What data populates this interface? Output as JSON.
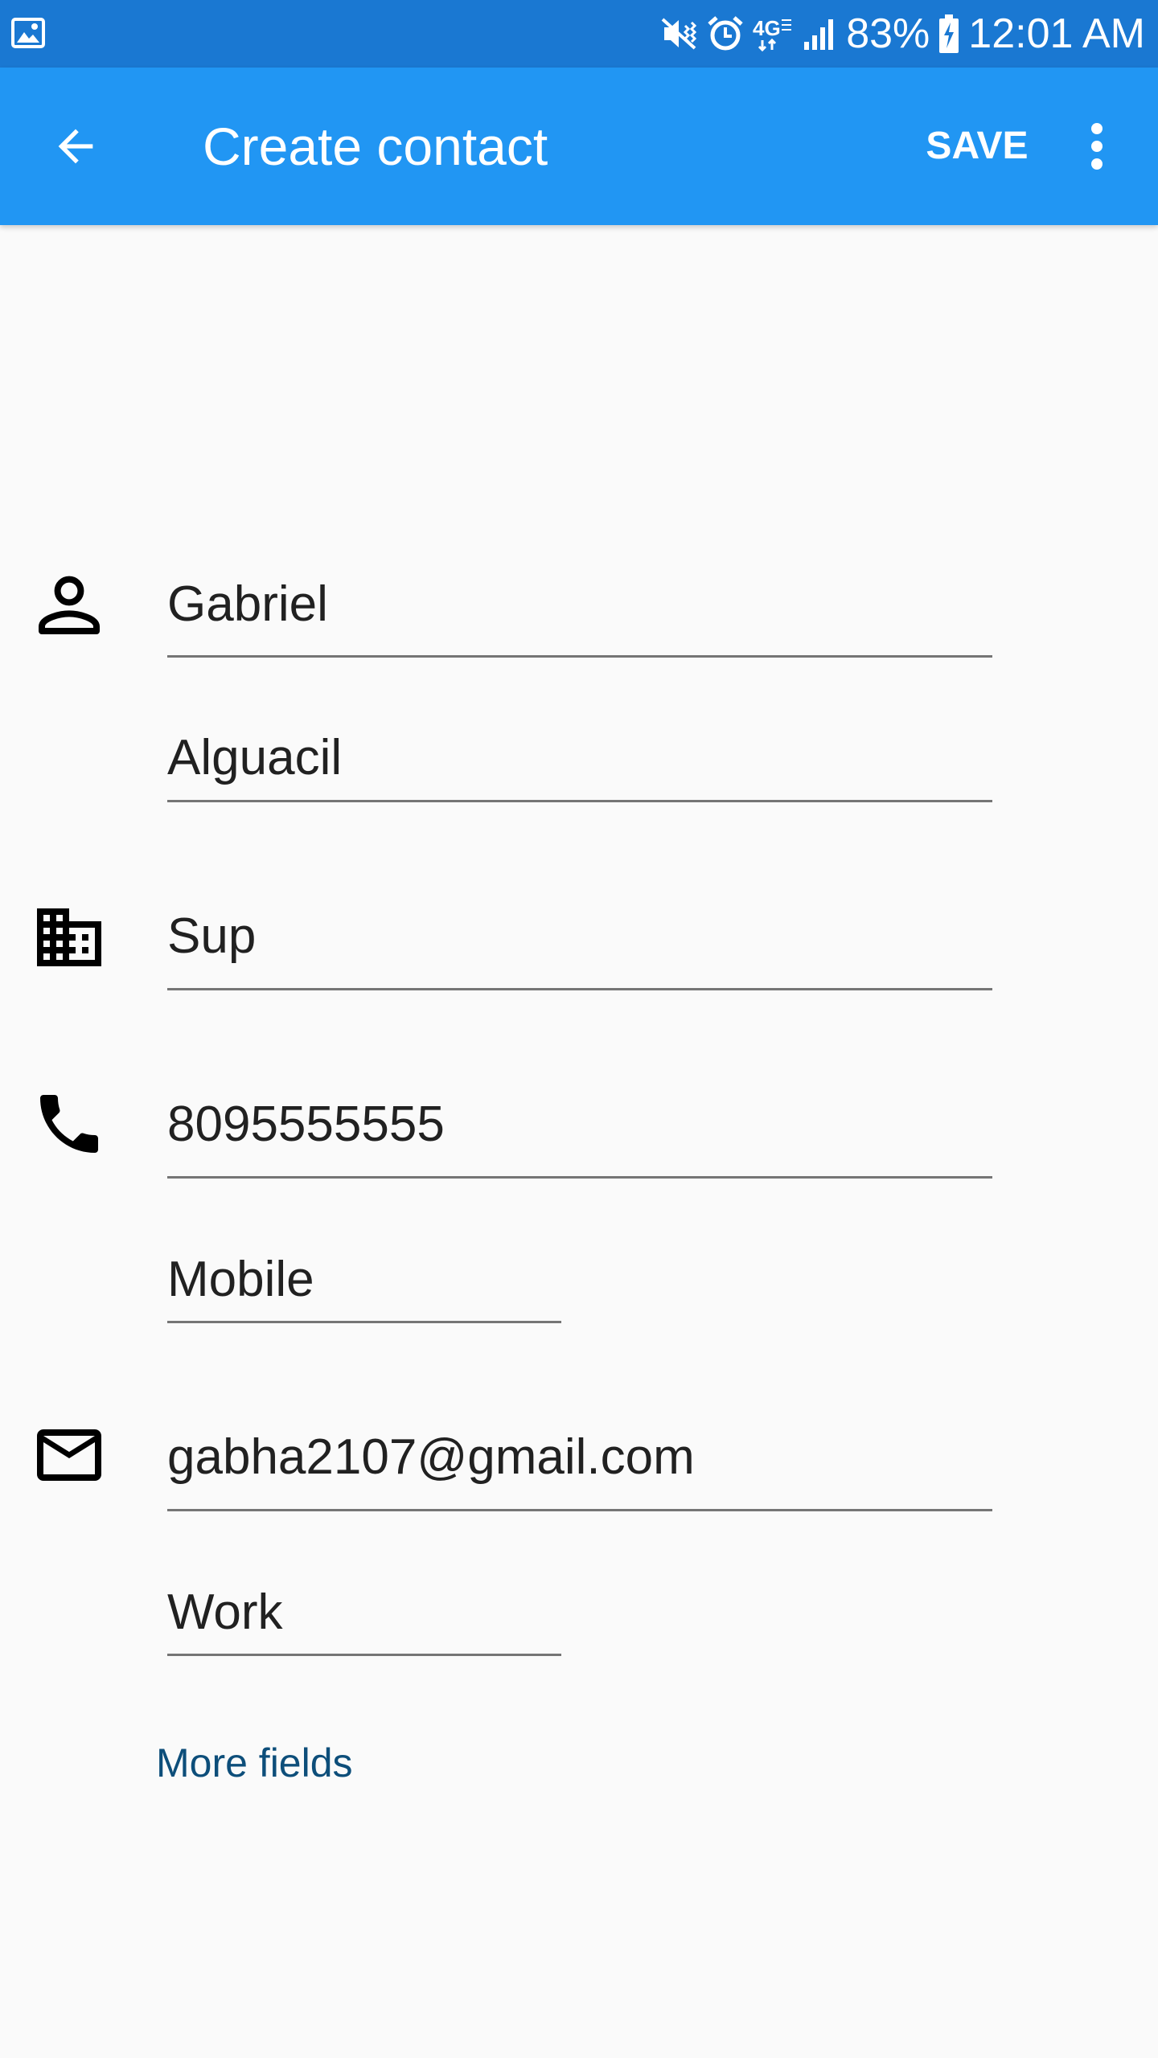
{
  "status_bar": {
    "battery": "83%",
    "time": "12:01 AM",
    "network": "4G",
    "icons": [
      "gallery-icon",
      "vibrate-mute-icon",
      "alarm-icon",
      "lte-icon",
      "signal-icon",
      "battery-charging-icon"
    ]
  },
  "app_bar": {
    "title": "Create contact",
    "save_label": "SAVE",
    "background": "#2196f3",
    "status_background": "#1a78d2"
  },
  "form": {
    "first_name": "Gabriel",
    "last_name": "Alguacil",
    "company": "Sup",
    "phone": "8095555555",
    "phone_type": "Mobile",
    "email": "gabha2107@gmail.com",
    "email_type": "Work",
    "more_fields_label": "More fields"
  },
  "colors": {
    "link": "#0d4e7a",
    "text": "#212121",
    "underline": "#757575"
  }
}
